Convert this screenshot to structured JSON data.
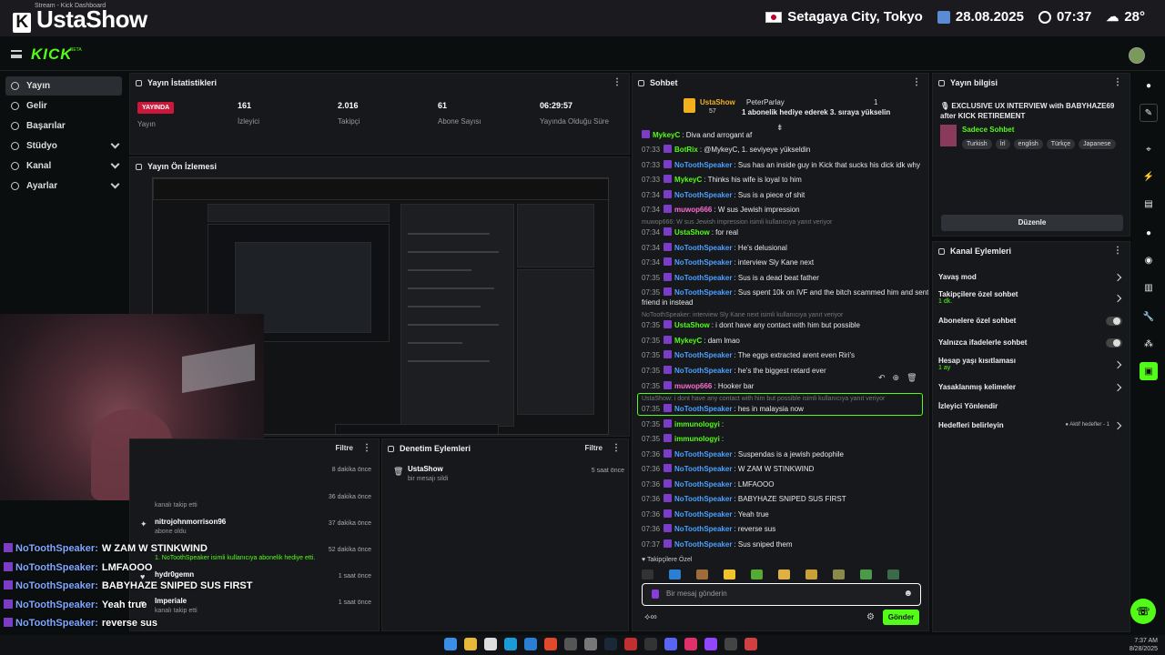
{
  "browser": {
    "tab_title": "Stream - Kick Dashboard"
  },
  "overlay": {
    "brand": "UstaShow",
    "location": "Setagaya City, Tokyo",
    "date": "28.08.2025",
    "time": "07:37",
    "temp": "28°"
  },
  "kick": {
    "logo": "KICK",
    "beta": "BETA"
  },
  "sidebar": {
    "items": [
      {
        "label": "Yayın",
        "active": true
      },
      {
        "label": "Gelir"
      },
      {
        "label": "Başarılar"
      },
      {
        "label": "Stüdyo",
        "expandable": true
      },
      {
        "label": "Kanal",
        "expandable": true
      },
      {
        "label": "Ayarlar",
        "expandable": true
      }
    ]
  },
  "stats": {
    "title": "Yayın İstatistikleri",
    "live_badge": "YAYINDA",
    "items": [
      {
        "value": "",
        "label": "Yayın"
      },
      {
        "value": "161",
        "label": "İzleyici"
      },
      {
        "value": "2.016",
        "label": "Takipçi"
      },
      {
        "value": "61",
        "label": "Abone Sayısı"
      },
      {
        "value": "06:29:57",
        "label": "Yayında Olduğu Süre"
      }
    ]
  },
  "preview": {
    "title": "Yayın Ön İzlemesi"
  },
  "activity": {
    "filter": "Filtre",
    "rows": [
      {
        "name": "",
        "sub": "",
        "time": "8 dakika önce"
      },
      {
        "name": "",
        "sub": "kanalı takip etti",
        "time": "36 dakika önce"
      },
      {
        "name": "nitrojohnmorrison96",
        "sub": "abone oldu",
        "time": "37 dakika önce"
      },
      {
        "name": "",
        "sub": "1. NoToothSpeaker isimli kullanıcıya abonelik hediye etti.",
        "time": "52 dakika önce"
      },
      {
        "name": "hydr0gemn",
        "sub": "",
        "time": "1 saat önce"
      },
      {
        "name": "Imperiale",
        "sub": "kanalı takip etti",
        "time": "1 saat önce"
      }
    ]
  },
  "moderation": {
    "title": "Denetim Eylemleri",
    "filter": "Filtre",
    "rows": [
      {
        "name": "UstaShow",
        "sub": "bir mesajı sildi",
        "time": "5 saat önce"
      }
    ]
  },
  "chat": {
    "title": "Sohbet",
    "pinned": {
      "user": "UstaShow",
      "count": "57",
      "gifter": "PeterParlay",
      "gift_count": "1",
      "text": "1 abonelik hediye ederek 3. sıraya yükselin"
    },
    "messages": [
      {
        "time": "",
        "user": "MykeyC",
        "color": "#53fc18",
        "text": "Diva and arrogant af"
      },
      {
        "time": "07:33",
        "user": "BotRix",
        "color": "#53fc18",
        "text": "@MykeyC, 1. seviyeye yükseldin"
      },
      {
        "time": "07:33",
        "user": "NoToothSpeaker",
        "color": "#4da0ff",
        "text": "Sus has an inside guy in Kick that sucks his dick idk why"
      },
      {
        "time": "07:33",
        "user": "MykeyC",
        "color": "#53fc18",
        "text": "Thinks his wife is loyal to him"
      },
      {
        "time": "07:34",
        "user": "NoToothSpeaker",
        "color": "#4da0ff",
        "text": "Sus is a piece of shit"
      },
      {
        "time": "07:34",
        "user": "muwop666",
        "color": "#ff6bd4",
        "text": "W sus Jewish impression"
      },
      {
        "time": "07:34",
        "user": "UstaShow",
        "color": "#53fc18",
        "text": "for real"
      },
      {
        "time": "07:34",
        "user": "NoToothSpeaker",
        "color": "#4da0ff",
        "text": "He's delusional"
      },
      {
        "time": "07:34",
        "user": "NoToothSpeaker",
        "color": "#4da0ff",
        "text": "interview Sly Kane next"
      },
      {
        "time": "07:35",
        "user": "NoToothSpeaker",
        "color": "#4da0ff",
        "text": "Sus is a dead beat father"
      },
      {
        "time": "07:35",
        "user": "NoToothSpeaker",
        "color": "#4da0ff",
        "text": "Sus spent 10k on IVF and the bitch scammed him and sent her"
      },
      {
        "time": "",
        "user": "",
        "color": "#e8e8e8",
        "text": "friend in instead"
      },
      {
        "time": "07:35",
        "user": "UstaShow",
        "color": "#53fc18",
        "text": "i dont have any contact with him but possible"
      },
      {
        "time": "07:35",
        "user": "MykeyC",
        "color": "#53fc18",
        "text": "dam lmao"
      },
      {
        "time": "07:35",
        "user": "NoToothSpeaker",
        "color": "#4da0ff",
        "text": "The eggs extracted arent even Riri's"
      },
      {
        "time": "07:35",
        "user": "NoToothSpeaker",
        "color": "#4da0ff",
        "text": "he's the biggest retard ever"
      },
      {
        "time": "07:35",
        "user": "muwop666",
        "color": "#ff6bd4",
        "text": "Hooker bar"
      },
      {
        "time": "07:35",
        "user": "NoToothSpeaker",
        "color": "#4da0ff",
        "text": "hes in malaysia now"
      },
      {
        "time": "07:35",
        "user": "immunologyi",
        "color": "#53fc18",
        "text": ""
      },
      {
        "time": "07:35",
        "user": "immunologyi",
        "color": "#53fc18",
        "text": ""
      },
      {
        "time": "07:36",
        "user": "NoToothSpeaker",
        "color": "#4da0ff",
        "text": "Suspendas is a jewish pedophile"
      },
      {
        "time": "07:36",
        "user": "NoToothSpeaker",
        "color": "#4da0ff",
        "text": "W ZAM W STINKWIND"
      },
      {
        "time": "07:36",
        "user": "NoToothSpeaker",
        "color": "#4da0ff",
        "text": "LMFAOOO"
      },
      {
        "time": "07:36",
        "user": "NoToothSpeaker",
        "color": "#4da0ff",
        "text": "BABYHAZE SNIPED SUS FIRST"
      },
      {
        "time": "07:36",
        "user": "NoToothSpeaker",
        "color": "#4da0ff",
        "text": "Yeah true"
      },
      {
        "time": "07:36",
        "user": "NoToothSpeaker",
        "color": "#4da0ff",
        "text": "reverse sus"
      },
      {
        "time": "07:37",
        "user": "NoToothSpeaker",
        "color": "#4da0ff",
        "text": "Sus sniped them"
      }
    ],
    "replies": [
      "muwop666: W sus Jewish impression isimli kullanıcıya yanıt veriyor",
      "NoToothSpeaker: interview Sly Kane next isimli kullanıcıya yanıt veriyor",
      "UstaShow: i dont have any contact with him but possible isimli kullanıcıya yanıt veriyor"
    ],
    "followers_only": "Takipçilere Özel",
    "input_placeholder": "Bir mesaj gönderin",
    "send_label": "Gönder"
  },
  "stream_info": {
    "title": "Yayın bilgisi",
    "stream_title": "🎙 EXCLUSIVE UX INTERVIEW with BABYHAZE69 after KICK RETIREMENT",
    "category": "Sadece Sohbet",
    "tags": [
      "Turkish",
      "İrl",
      "english",
      "Türkçe",
      "Japanese"
    ],
    "edit_label": "Düzenle"
  },
  "channel_actions": {
    "title": "Kanal Eylemleri",
    "rows": [
      {
        "label": "Yavaş mod",
        "sub": "",
        "control": "chevron"
      },
      {
        "label": "Takipçilere özel sohbet",
        "sub": "1 dk.",
        "control": "chevron"
      },
      {
        "label": "Abonelere özel sohbet",
        "sub": "",
        "control": "toggle"
      },
      {
        "label": "Yalnızca ifadelerle sohbet",
        "sub": "",
        "control": "toggle"
      },
      {
        "label": "Hesap yaşı kısıtlaması",
        "sub": "1 ay",
        "control": "chevron"
      },
      {
        "label": "Yasaklanmış kelimeler",
        "sub": "",
        "control": "chevron"
      },
      {
        "label": "İzleyici Yönlendir",
        "sub": "",
        "control": "none"
      },
      {
        "label": "Hedefleri belirleyin",
        "sub": "",
        "control": "chevron",
        "extra": "● Aktif hedefler - 1"
      }
    ]
  },
  "overlay_chat": [
    {
      "user": "NoToothSpeaker:",
      "text": "W ZAM W STINKWIND"
    },
    {
      "user": "NoToothSpeaker:",
      "text": "LMFAOOO"
    },
    {
      "user": "NoToothSpeaker:",
      "text": "BABYHAZE SNIPED SUS FIRST"
    },
    {
      "user": "NoToothSpeaker:",
      "text": "Yeah true"
    },
    {
      "user": "NoToothSpeaker:",
      "text": "reverse sus"
    },
    {
      "user": "NoToothSpeaker:",
      "text": "Sus sniped them"
    }
  ],
  "taskbar": {
    "time": "7:37 AM",
    "date": "8/28/2025"
  },
  "colors": {
    "accent": "#53fc18",
    "live": "#c9183b",
    "panel": "#16181b"
  }
}
